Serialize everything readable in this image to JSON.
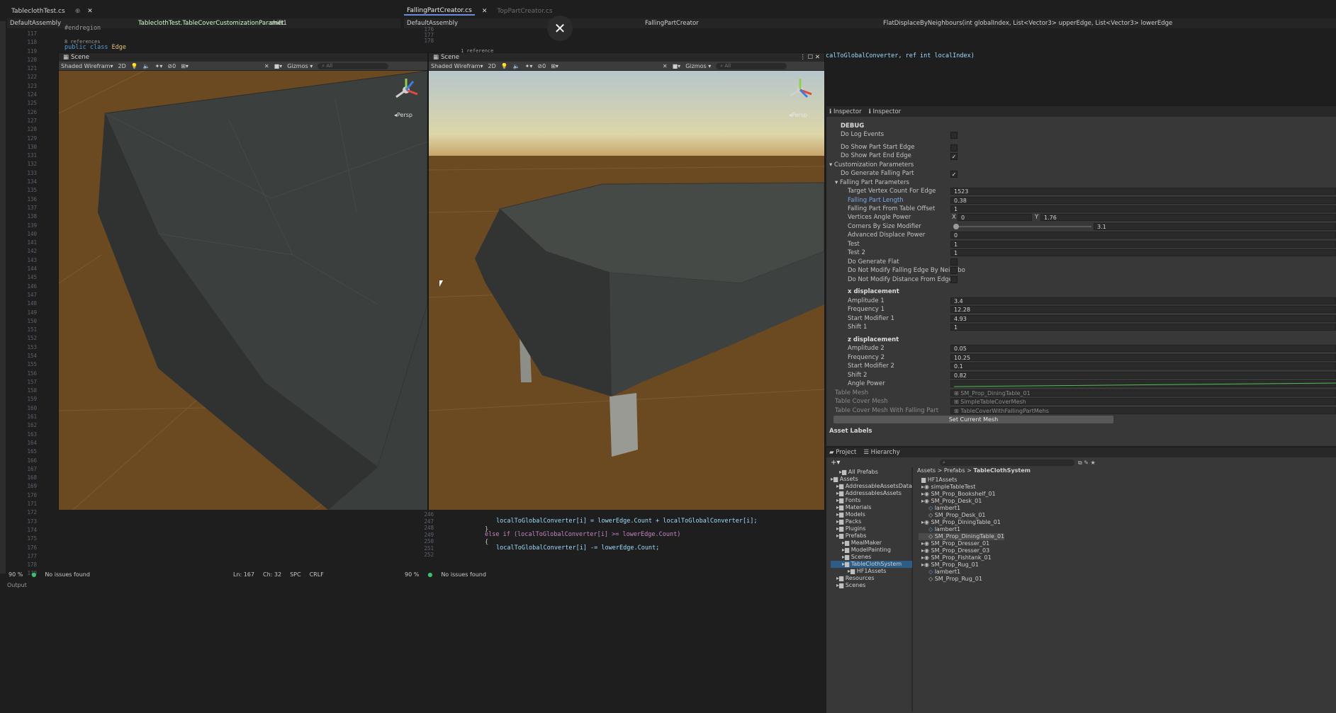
{
  "left_editor": {
    "tabs": [
      {
        "label": "TableclothTest.cs"
      }
    ],
    "nav": [
      "DefaultAssembly",
      "TableclothTest.TableCoverCustomizationParamet",
      "shift1"
    ],
    "line_numbers": [
      "117",
      "118",
      "119",
      "120",
      "121",
      "122",
      "123",
      "124",
      "125",
      "126",
      "127",
      "128",
      "129",
      "130",
      "131",
      "132",
      "133",
      "134",
      "135",
      "136",
      "137",
      "138",
      "139",
      "140",
      "141",
      "142",
      "143",
      "144",
      "145",
      "146",
      "147",
      "148",
      "149",
      "150",
      "151",
      "152",
      "153",
      "154",
      "155",
      "156",
      "157",
      "158",
      "159",
      "160",
      "161",
      "162",
      "163",
      "164",
      "165",
      "166",
      "167",
      "168",
      "169",
      "170",
      "171",
      "172",
      "173",
      "174",
      "175",
      "176",
      "177",
      "178",
      "179"
    ],
    "code_endregion": "#endregion",
    "code_refs": "8 references",
    "code_public": "public",
    "code_class": "class",
    "code_edge": "Edge",
    "status": {
      "zoom": "90 %",
      "issues": "No issues found",
      "ln": "Ln: 167",
      "ch": "Ch: 32",
      "spc": "SPC",
      "crlf": "CRLF"
    },
    "output_label": "Output"
  },
  "right_editor": {
    "tabs": [
      {
        "label": "FallingPartCreator.cs"
      },
      {
        "label": "TopPartCreator.cs"
      }
    ],
    "nav": [
      "DefaultAssembly",
      "FallingPartCreator",
      "FlatDisplaceByNeighbours(int globalIndex, List<Vector3> upperEdge, List<Vector3> lowerEdge"
    ],
    "line_numbers_top": [
      "176",
      "177",
      "178"
    ],
    "refs": "1 reference",
    "code_signature": "calToGlobalConverter, ref int localIndex)",
    "line_numbers_bottom": [
      "246",
      "247",
      "248",
      "249",
      "250",
      "251",
      "252"
    ],
    "code_line1": "localToGlobalConverter[i] = lowerEdge.Count + localToGlobalConverter[i];",
    "code_brace": "}",
    "code_else": "else if (localToGlobalConverter[i] >= lowerEdge.Count)",
    "code_open": "{",
    "code_line2": "localToGlobalConverter[i] -= lowerEdge.Count;",
    "status": {
      "zoom": "90 %",
      "issues": "No issues found"
    }
  },
  "scene_left": {
    "tab": "Scene",
    "shading": "Shaded Wirefram",
    "mode_2d": "2D",
    "gizmos": "Gizmos",
    "search_placeholder": "All",
    "fx_count": "0",
    "persp": "Persp"
  },
  "scene_right": {
    "tab": "Scene",
    "shading": "Shaded Wirefram",
    "mode_2d": "2D",
    "gizmos": "Gizmos",
    "search_placeholder": "All",
    "fx_count": "0",
    "persp": "Persp"
  },
  "inspector": {
    "tabs": [
      "Inspector",
      "Inspector"
    ],
    "debug_header": "DEBUG",
    "rows": [
      {
        "label": "Do Log Events",
        "checked": false
      },
      {
        "label": "Do Show Part Start Edge",
        "checked": false
      },
      {
        "label": "Do Show Part End Edge",
        "checked": true
      }
    ],
    "custom_header": "Customization Parameters",
    "do_generate_falling": {
      "label": "Do Generate Falling Part",
      "checked": true
    },
    "falling_header": "Falling Part Parameters",
    "fields": [
      {
        "label": "Target Vertex Count For Edge",
        "value": "1523"
      },
      {
        "label": "Falling Part Length",
        "value": "0.38"
      },
      {
        "label": "Falling Part From Table Offset",
        "value": "1"
      }
    ],
    "angle_power": {
      "label": "Vertices Angle Power",
      "x_label": "X",
      "x": "0",
      "y_label": "Y",
      "y": "1.76"
    },
    "corners": {
      "label": "Corners By Size Modifier",
      "value": "3.1"
    },
    "fields2": [
      {
        "label": "Advanced Displace Power",
        "value": "0"
      },
      {
        "label": "Test",
        "value": "1"
      },
      {
        "label": "Test 2",
        "value": "1"
      }
    ],
    "checks2": [
      {
        "label": "Do Generate Flat",
        "checked": false
      },
      {
        "label": "Do Not Modify Falling Edge By Neighbo",
        "checked": false
      },
      {
        "label": "Do Not Modify Distance From Edge",
        "checked": false
      }
    ],
    "x_header": "x displacement",
    "x_fields": [
      {
        "label": "Amplitude 1",
        "value": "3.4"
      },
      {
        "label": "Frequency 1",
        "value": "12.28"
      },
      {
        "label": "Start Modifier 1",
        "value": "4.93"
      },
      {
        "label": "Shift 1",
        "value": "1"
      }
    ],
    "z_header": "z displacement",
    "z_fields": [
      {
        "label": "Amplitude 2",
        "value": "0.05"
      },
      {
        "label": "Frequency 2",
        "value": "10.25"
      },
      {
        "label": "Start Modifier 2",
        "value": "0.1"
      },
      {
        "label": "Shift 2",
        "value": "0.82"
      }
    ],
    "angle_power_curve": "Angle Power",
    "mesh_fields": [
      {
        "label": "Table Mesh",
        "value": "SM_Prop_DiningTable_01"
      },
      {
        "label": "Table Cover Mesh",
        "value": "SimpleTableCoverMesh"
      },
      {
        "label": "Table Cover Mesh With Falling Part",
        "value": "TableCoverWithFallingPartMehs"
      }
    ],
    "set_mesh_button": "Set Current Mesh",
    "asset_labels": "Asset Labels"
  },
  "project": {
    "tabs": [
      "Project",
      "Hierarchy"
    ],
    "add": "+",
    "search_placeholder": "",
    "breadcrumb": [
      "Assets",
      "Prefabs",
      "TableClothSystem"
    ],
    "left_tree": [
      "All Prefabs",
      "Assets",
      "AddressableAssetsData",
      "AddressablesAssets",
      "Fonts",
      "Materials",
      "Models",
      "Packs",
      "Plugins",
      "Prefabs",
      "MealMaker",
      "ModelPainting",
      "Scenes",
      "TableClothSystem",
      "HF1Assets",
      "Resources",
      "Scenes"
    ],
    "right_tree": [
      "HF1Assets",
      "simpleTableTest",
      "SM_Prop_Bookshelf_01",
      "SM_Prop_Desk_01",
      "lambert1",
      "SM_Prop_Desk_01",
      "SM_Prop_DiningTable_01",
      "lambert1",
      "SM_Prop_DiningTable_01",
      "SM_Prop_Dresser_01",
      "SM_Prop_Dresser_03",
      "SM_Prop_Fishtank_01",
      "SM_Prop_Rug_01",
      "lambert1",
      "SM_Prop_Rug_01"
    ]
  },
  "overlay": {
    "close_glyph": "✕"
  },
  "colors": {
    "ground": "#6b4a22",
    "sky_top": "#b7c6cc",
    "mesh": "#3a3e3c",
    "accent": "#6a8bd8"
  }
}
